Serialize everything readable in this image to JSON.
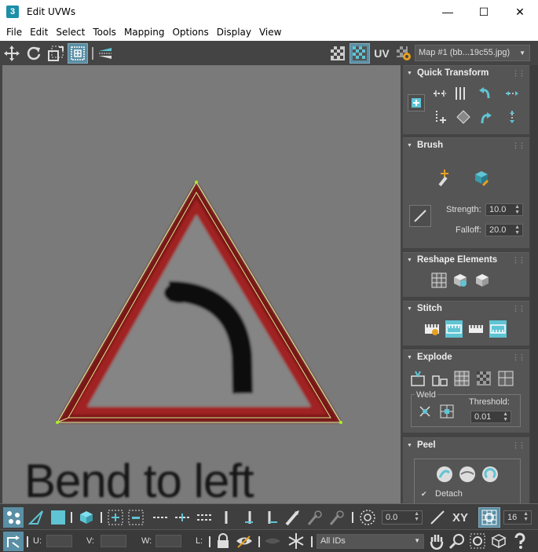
{
  "window": {
    "title": "Edit UVWs",
    "app_icon_text": "3",
    "minimize": "—",
    "maximize": "☐",
    "close": "✕"
  },
  "menu": [
    "File",
    "Edit",
    "Select",
    "Tools",
    "Mapping",
    "Options",
    "Display",
    "View"
  ],
  "toolbar": {
    "uv_label": "UV",
    "map_select": "Map #1 (bb...19c55.jpg)"
  },
  "viewport": {
    "texture_text": "Bend to left"
  },
  "panels": {
    "quick_transform": {
      "title": "Quick Transform"
    },
    "brush": {
      "title": "Brush",
      "strength_label": "Strength:",
      "strength_value": "10.0",
      "falloff_label": "Falloff:",
      "falloff_value": "20.0"
    },
    "reshape": {
      "title": "Reshape Elements"
    },
    "stitch": {
      "title": "Stitch"
    },
    "explode": {
      "title": "Explode",
      "weld_label": "Weld",
      "threshold_label": "Threshold:",
      "threshold_value": "0.01"
    },
    "peel": {
      "title": "Peel",
      "detach_label": "Detach"
    }
  },
  "bottom": {
    "angle_value": "0.0",
    "xy_label": "XY",
    "grid_value": "16",
    "u_label": "U:",
    "v_label": "V:",
    "w_label": "W:",
    "l_label": "L:",
    "ids_select": "All IDs"
  },
  "colors": {
    "accent": "#5fc4d4",
    "ui_dark": "#444444",
    "viewport": "#7a7a7a",
    "sign_red": "#8b1a1a"
  }
}
